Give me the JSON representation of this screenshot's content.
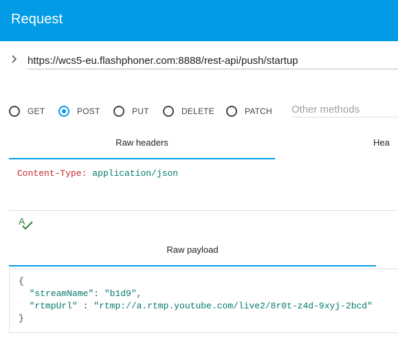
{
  "header": {
    "title": "Request"
  },
  "url": {
    "value": "https://wcs5-eu.flashphoner.com:8888/rest-api/push/startup"
  },
  "methods": {
    "options": [
      "GET",
      "POST",
      "PUT",
      "DELETE",
      "PATCH"
    ],
    "selected": "POST",
    "other_placeholder": "Other methods"
  },
  "tabs": {
    "raw_headers": "Raw headers",
    "headers": "Hea"
  },
  "headers_editor": {
    "key": "Content-Type:",
    "value": "application/json"
  },
  "payload": {
    "tab_label": "Raw payload",
    "open_brace": "{",
    "close_brace": "}",
    "line1_key": "\"streamName\"",
    "line1_sep": ": ",
    "line1_value": "\"b1d9\"",
    "line1_end": ",",
    "line2_key": "\"rtmpUrl\"",
    "line2_sep": " : ",
    "line2_value": "\"rtmp://a.rtmp.youtube.com/live2/8r0t-z4d-9xyj-2bcd\""
  },
  "colors": {
    "accent": "#039be5",
    "header_key": "#c62828",
    "string": "#00796b",
    "validate": "#2e7d32"
  }
}
